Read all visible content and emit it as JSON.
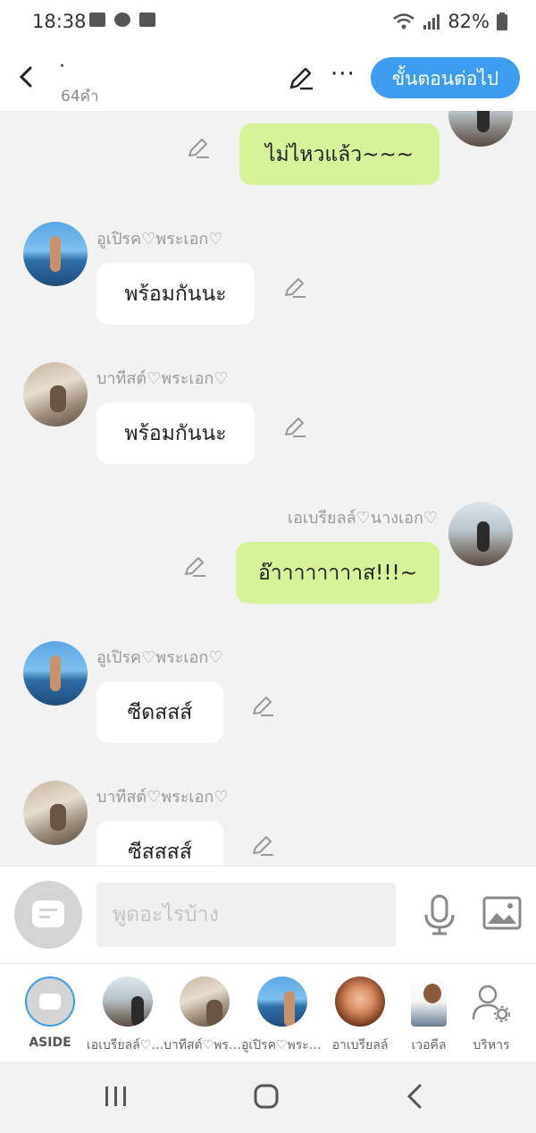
{
  "status_bar": {
    "time": "18:38",
    "battery": "82%",
    "icons": [
      "image-icon",
      "cast-icon",
      "folder-icon",
      "wifi-icon",
      "signal-icon",
      "battery-icon"
    ]
  },
  "header": {
    "title": "·",
    "word_count": "64คำ",
    "next_label": "ขั้นตอนต่อไป",
    "accent_color": "#3c9cf0"
  },
  "messages": [
    {
      "side": "right",
      "sender": "",
      "text": "ไม่ไหวแล้ว~~~",
      "color": "#d6f39a"
    },
    {
      "side": "left",
      "sender": "อูเปิรค♡พระเอก♡",
      "text": "พร้อมกันนะ",
      "color": "#ffffff"
    },
    {
      "side": "left",
      "sender": "บาทีสต์♡พระเอก♡",
      "text": "พร้อมกันนะ",
      "color": "#ffffff"
    },
    {
      "side": "right",
      "sender": "เอเบรียลล์♡นางเอก♡",
      "text": "อ๊าาาาาาาาส!!!~",
      "color": "#d6f39a"
    },
    {
      "side": "left",
      "sender": "อูเปิรค♡พระเอก♡",
      "text": "ซีดสสส์",
      "color": "#ffffff"
    },
    {
      "side": "left",
      "sender": "บาทีสต์♡พระเอก♡",
      "text": "ซีสสสส์",
      "color": "#ffffff"
    }
  ],
  "input": {
    "placeholder": "พูดอะไรบ้าง"
  },
  "characters": [
    {
      "label": "ASIDE"
    },
    {
      "label": "เอเบรียลล์♡นางเอก♡"
    },
    {
      "label": "บาทีสต์♡พระเอก♡"
    },
    {
      "label": "อูเปิรค♡พระเอก♡"
    },
    {
      "label": "อาเบรียลล์"
    },
    {
      "label": "เวอคีล"
    },
    {
      "label": "บริหาร"
    }
  ]
}
